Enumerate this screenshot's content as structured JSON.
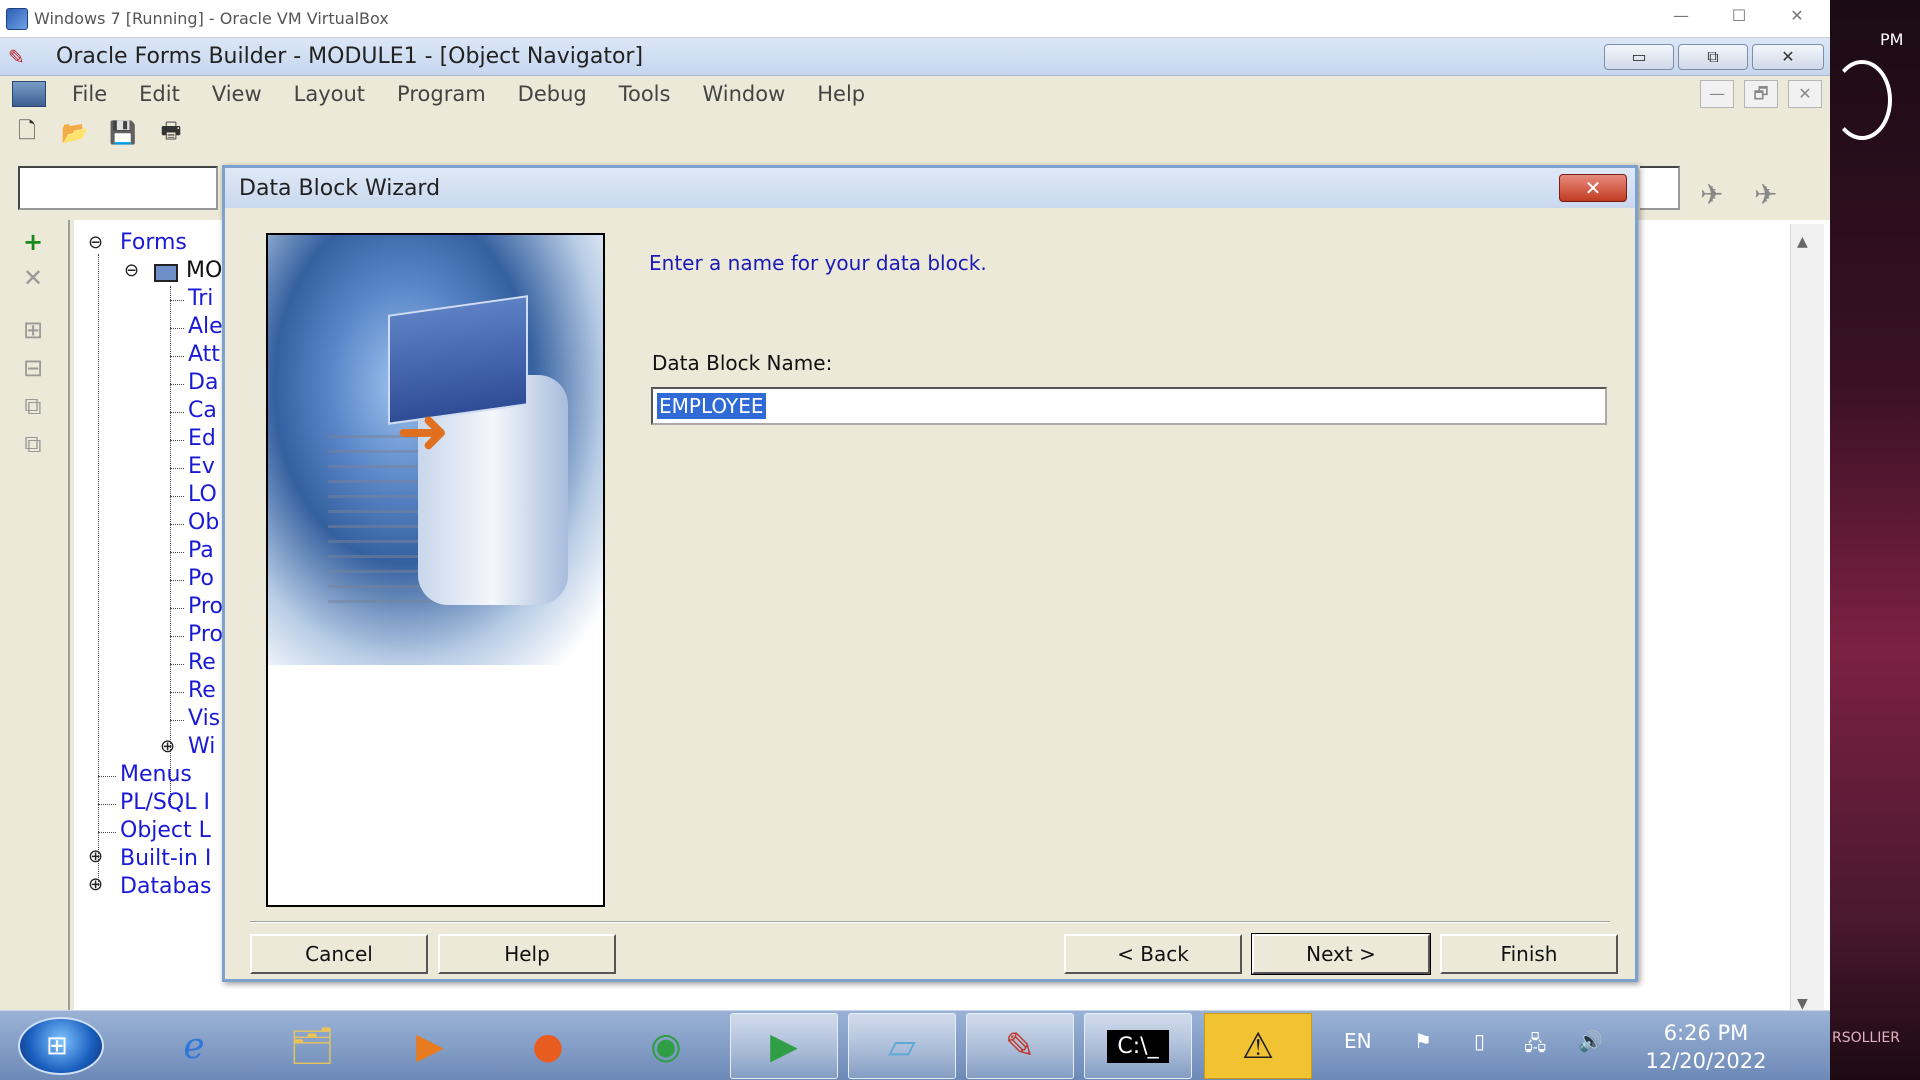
{
  "host_window": {
    "title": "Windows 7 [Running] - Oracle VM VirtualBox",
    "minimize": "—",
    "maximize": "☐",
    "close": "✕"
  },
  "desktop": {
    "clock_fragment": "PM",
    "signature": "RSOLLIER"
  },
  "app": {
    "title": "Oracle Forms Builder - MODULE1 - [Object Navigator]",
    "menu": [
      "File",
      "Edit",
      "View",
      "Layout",
      "Program",
      "Debug",
      "Tools",
      "Window",
      "Help"
    ],
    "window_buttons": {
      "minimize": "▭",
      "restore": "⧉",
      "close": "✕"
    },
    "mdi_buttons": {
      "minimize": "—",
      "restore": "🗗",
      "close": "✕"
    }
  },
  "navigator": {
    "root": "Forms",
    "module": "MO",
    "form_children": [
      "Tri",
      "Ale",
      "Att",
      "Da",
      "Ca",
      "Ed",
      "Ev",
      "LO",
      "Ob",
      "Pa",
      "Po",
      "Pro",
      "Pro",
      "Re",
      "Re",
      "Vis",
      "Wi"
    ],
    "top_nodes": [
      "Menus",
      "PL/SQL I",
      "Object L",
      "Built-in I",
      "Databas"
    ]
  },
  "dialog": {
    "title": "Data Block Wizard",
    "prompt": "Enter a name for your data block.",
    "field_label": "Data Block Name:",
    "field_value": "EMPLOYEE",
    "buttons": {
      "cancel": "Cancel",
      "help": "Help",
      "back": "< Back",
      "next": "Next >",
      "finish": "Finish"
    },
    "close": "✕"
  },
  "taskbar": {
    "language": "EN",
    "time": "6:26 PM",
    "date": "12/20/2022"
  },
  "colors": {
    "link_blue": "#1a1ad6",
    "selection": "#2f6ad6",
    "dialog_bg": "#ece9d8"
  }
}
